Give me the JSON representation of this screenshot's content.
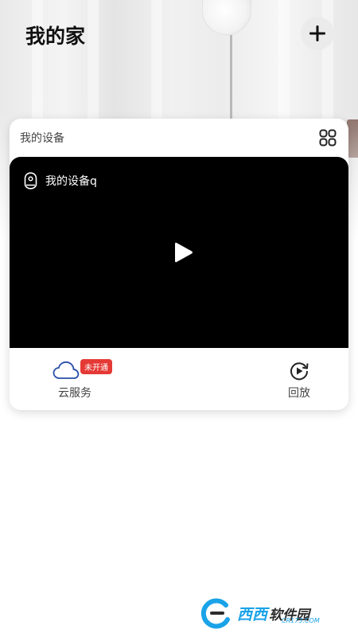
{
  "header": {
    "title": "我的家",
    "add_icon": "plus-icon"
  },
  "device_card": {
    "title": "我的设备",
    "grid_icon": "grid-layout-icon",
    "video": {
      "device_name": "我的设备q",
      "camera_icon": "camera-icon",
      "play_icon": "play-icon"
    },
    "footer": {
      "cloud_label": "云服务",
      "cloud_badge": "未开通",
      "cloud_icon": "cloud-icon",
      "playback_label": "回放",
      "playback_icon": "playback-icon"
    }
  },
  "watermark": {
    "brand": "西西",
    "suffix": "软件园",
    "domain": "CR173.COM"
  },
  "colors": {
    "badge": "#e53935",
    "cloud_icon": "#2a4fa8",
    "video_bg": "#000000"
  }
}
